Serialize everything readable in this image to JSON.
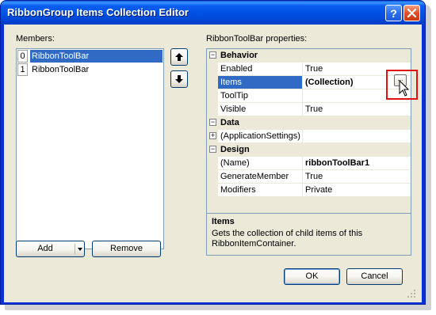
{
  "window": {
    "title": "RibbonGroup Items Collection Editor",
    "help_glyph": "?",
    "close_glyph": "✕"
  },
  "members": {
    "label": "Members:",
    "items": [
      {
        "index": "0",
        "text": "RibbonToolBar",
        "selected": true
      },
      {
        "index": "1",
        "text": "RibbonToolBar",
        "selected": false
      }
    ]
  },
  "buttons": {
    "add": "Add",
    "remove": "Remove",
    "ok": "OK",
    "cancel": "Cancel"
  },
  "properties": {
    "label": "RibbonToolBar properties:",
    "categories": [
      {
        "name": "Behavior",
        "toggle": "−",
        "rows": [
          {
            "name": "Enabled",
            "value": "True"
          },
          {
            "name": "Items",
            "value": "(Collection)",
            "ellipsis": "..."
          },
          {
            "name": "ToolTip",
            "value": ""
          },
          {
            "name": "Visible",
            "value": "True"
          }
        ]
      },
      {
        "name": "Data",
        "toggle": "−",
        "rows": [
          {
            "name": "(ApplicationSettings)",
            "value": "",
            "toggle": "+"
          }
        ]
      },
      {
        "name": "Design",
        "toggle": "−",
        "rows": [
          {
            "name": "(Name)",
            "value": "ribbonToolBar1"
          },
          {
            "name": "GenerateMember",
            "value": "True"
          },
          {
            "name": "Modifiers",
            "value": "Private"
          }
        ]
      }
    ]
  },
  "description": {
    "title": "Items",
    "text": "Gets the collection of child items of this RibbonItemContainer."
  },
  "colors": {
    "titlebar": "#0052e3",
    "selection": "#316ac5",
    "dialog_bg": "#ece9d8",
    "highlight": "#e01010"
  },
  "icons": [
    "help-icon",
    "close-icon",
    "move-up-icon",
    "move-down-icon",
    "split-dropdown-icon",
    "ellipsis-icon",
    "mouse-cursor-icon",
    "resize-grip-icon"
  ]
}
